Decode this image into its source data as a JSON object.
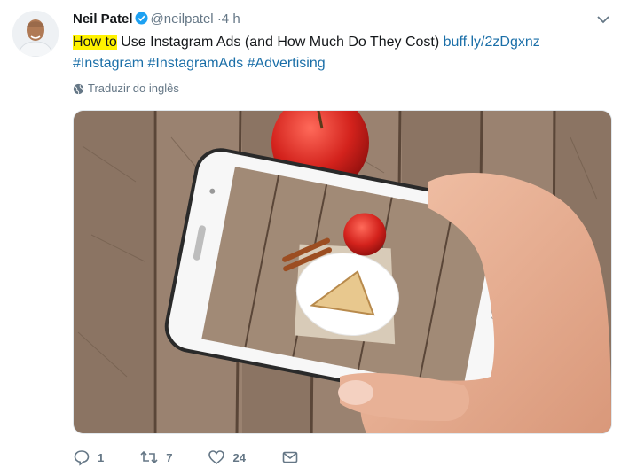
{
  "tweet": {
    "author_name": "Neil Patel",
    "handle": "@neilpatel",
    "time": "·4 h",
    "text_highlight": "How to",
    "text_body": " Use Instagram Ads (and How Much Do They Cost) ",
    "link": "buff.ly/2zDgxnz",
    "hashtags": [
      "#Instagram",
      "#InstagramAds",
      "#Advertising"
    ],
    "translate_label": "Traduzir do inglês"
  },
  "actions": {
    "reply_count": "1",
    "retweet_count": "7",
    "like_count": "24"
  },
  "colors": {
    "link": "#1b6fa8",
    "highlight": "#fff200",
    "muted": "#657786",
    "verified": "#1da1f2"
  }
}
